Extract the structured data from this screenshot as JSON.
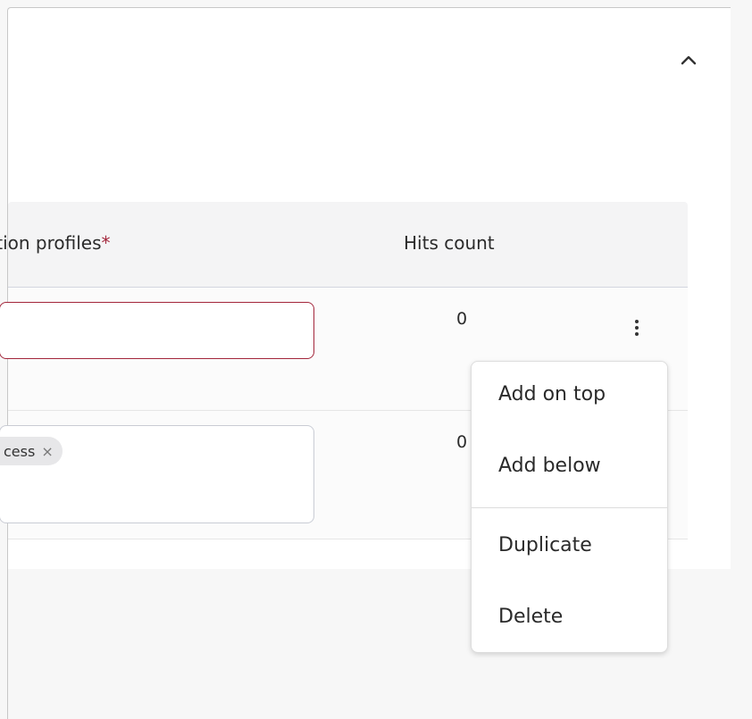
{
  "table": {
    "headers": {
      "profiles": "ation profiles",
      "profiles_required_mark": "*",
      "hits": "Hits count"
    },
    "rows": [
      {
        "hits": "0"
      },
      {
        "chip_label": "cess",
        "chip_remove": "×",
        "hits": "0"
      }
    ]
  },
  "menu": {
    "items": [
      "Add on top",
      "Add below",
      "Duplicate",
      "Delete"
    ]
  },
  "icons": {
    "collapse": "chevron-up-icon",
    "row_actions": "kebab-menu-icon"
  },
  "colors": {
    "required_accent": "#a3263b",
    "header_bg": "#f4f4f5"
  }
}
